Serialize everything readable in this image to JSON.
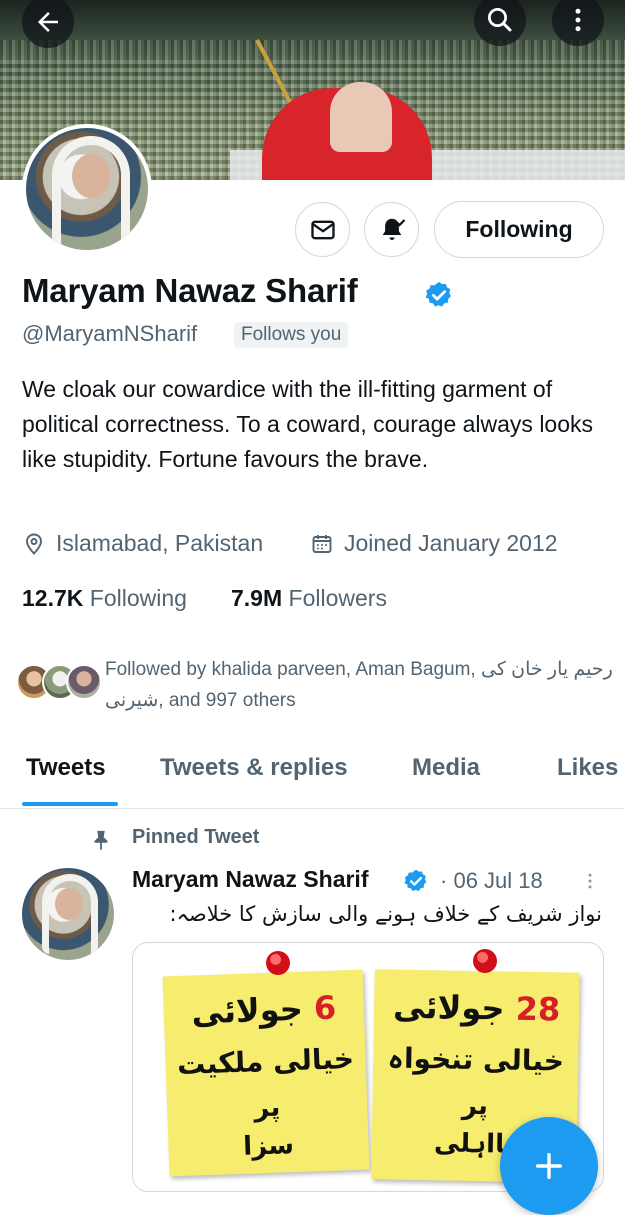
{
  "header": {
    "back_icon": "arrow-left-icon",
    "search_icon": "search-icon",
    "more_icon": "more-vertical-icon"
  },
  "profile": {
    "name": "Maryam Nawaz Sharif",
    "handle": "@MaryamNSharif",
    "follows_you": "Follows you",
    "bio": "We cloak our cowardice with the ill-fitting garment of political correctness. To a coward, courage always looks like stupidity. Fortune favours the brave.",
    "location": "Islamabad, Pakistan",
    "joined": "Joined January 2012",
    "following_count": "12.7K",
    "following_label": "Following",
    "followers_count": "7.9M",
    "followers_label": "Followers",
    "followed_by": "Followed by khalida parveen, Aman Bagum, رحیم یار خان کی شیرنی, and 997 others"
  },
  "actions": {
    "message_icon": "envelope-icon",
    "notify_icon": "bell-check-icon",
    "following_button": "Following"
  },
  "tabs": [
    {
      "label": "Tweets",
      "active": true
    },
    {
      "label": "Tweets & replies",
      "active": false
    },
    {
      "label": "Media",
      "active": false
    },
    {
      "label": "Likes",
      "active": false
    }
  ],
  "pinned_tweet": {
    "pinned_label": "Pinned Tweet",
    "author": "Maryam Nawaz Sharif",
    "separator": "·",
    "date": "06 Jul 18",
    "text": "نواز شریف کے خلاف ہونے والی سازش کا خلاصہ:",
    "notes": [
      {
        "num": "6",
        "month": "جولائی",
        "line2": "خیالی ملکیت",
        "line3": "پر",
        "line4": "سزا"
      },
      {
        "num": "28",
        "month": "جولائی",
        "line2": "خیالی تنخواہ",
        "line3": "پر",
        "line4": "نااہلی"
      }
    ]
  },
  "fab": {
    "icon": "plus-icon"
  },
  "colors": {
    "accent": "#1d9bf0",
    "text": "#0f1419",
    "secondary": "#536471"
  }
}
